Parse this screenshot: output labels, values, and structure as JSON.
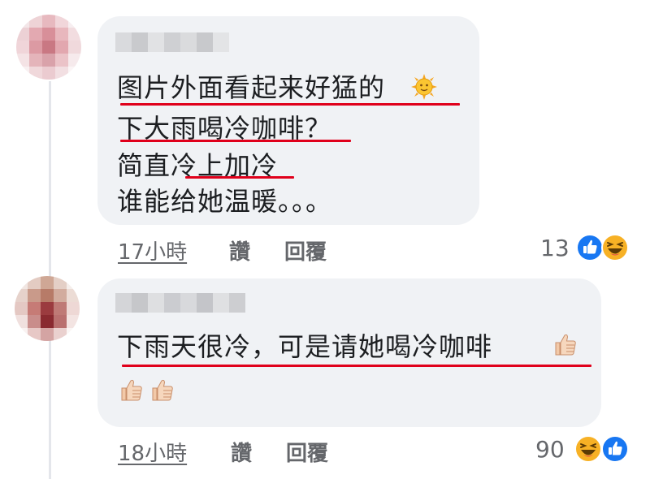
{
  "comments": [
    {
      "lines": [
        "图片外面看起来好猛的",
        "下大雨喝冷咖啡？",
        "简直冷上加冷",
        "谁能给她温暖。。。"
      ],
      "emojis": [
        "sun-with-face-icon"
      ],
      "time": "17小時",
      "like_label": "讚",
      "reply_label": "回覆",
      "reaction_count": "13",
      "reaction_icons": [
        "like-reaction-icon",
        "haha-reaction-icon"
      ]
    },
    {
      "lines": [
        "下雨天很冷，可是请她喝冷咖啡"
      ],
      "emojis": [
        "thumbs-up-icon",
        "thumbs-up-icon",
        "thumbs-up-icon"
      ],
      "time": "18小時",
      "like_label": "讚",
      "reply_label": "回覆",
      "reaction_count": "90",
      "reaction_icons": [
        "haha-reaction-icon",
        "like-reaction-icon"
      ]
    }
  ],
  "colors": {
    "bubble": "#f0f2f5",
    "highlight_underline": "#e0001b",
    "meta_text": "#65676b",
    "like_blue": "#1877f2",
    "haha_yellow": "#f7b125"
  }
}
